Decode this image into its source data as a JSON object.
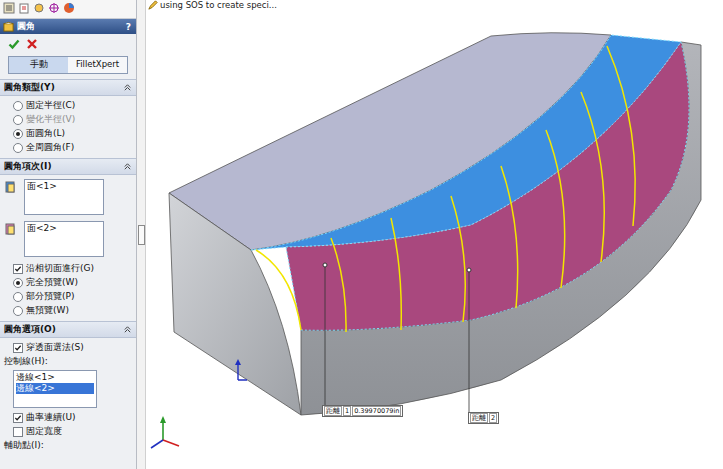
{
  "panel": {
    "title": "圓角",
    "help": "?",
    "modes": [
      {
        "label": "手動",
        "selected": true
      },
      {
        "label": "FilletXpert",
        "selected": false
      }
    ],
    "fillet_type": {
      "title": "圓角類型(Y)",
      "options": [
        {
          "label": "固定半徑(C)",
          "selected": false,
          "disabled": false
        },
        {
          "label": "變化半徑(V)",
          "selected": false,
          "disabled": true
        },
        {
          "label": "面圓角(L)",
          "selected": true,
          "disabled": false
        },
        {
          "label": "全周圓角(F)",
          "selected": false,
          "disabled": false
        }
      ]
    },
    "fillet_items": {
      "title": "圓角項次(I)",
      "face_sets": [
        {
          "items": [
            "面<1>"
          ],
          "color": "#3d8fe0"
        },
        {
          "items": [
            "面<2>"
          ],
          "color": "#e87ab4"
        }
      ],
      "tangent": {
        "label": "沿相切面進行(G)",
        "checked": true
      },
      "preview": [
        {
          "label": "完全預覽(W)",
          "selected": true
        },
        {
          "label": "部分預覽(P)",
          "selected": false
        },
        {
          "label": "無預覽(W)",
          "selected": false
        }
      ]
    },
    "fillet_options": {
      "title": "圓角選項(O)",
      "through_face": {
        "label": "穿透面選法(S)",
        "checked": true
      },
      "control_lines_label": "控制線(H):",
      "control_lines": [
        {
          "label": "邊線<1>",
          "selected": false
        },
        {
          "label": "邊線<2>",
          "selected": true
        }
      ],
      "checks": [
        {
          "label": "曲率連續(U)",
          "checked": true
        },
        {
          "label": "固定寬度",
          "checked": false
        }
      ],
      "help_points_label": "輔助點(I):"
    }
  },
  "viewport": {
    "hint": "using SOS to create speci...",
    "callouts": [
      {
        "parts": [
          "距離",
          "1",
          "0.39970079in"
        ]
      },
      {
        "parts": [
          "距離",
          "2"
        ]
      }
    ]
  }
}
